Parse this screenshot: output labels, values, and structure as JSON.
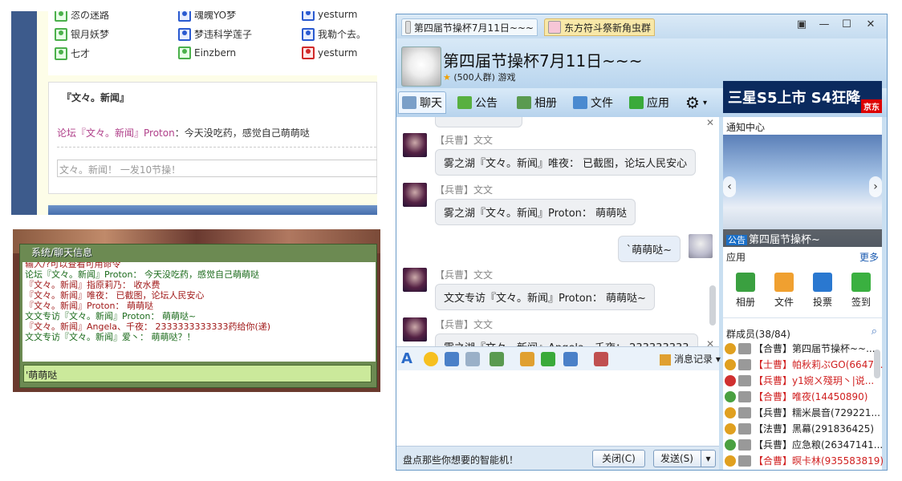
{
  "forum": {
    "users": [
      {
        "name": "恣の迷路",
        "color": "green"
      },
      {
        "name": "魂魄YO梦",
        "color": "blue"
      },
      {
        "name": "yesturm",
        "color": "blue"
      },
      {
        "name": "银月妖梦",
        "color": "green"
      },
      {
        "name": "梦违科学莲子",
        "color": "blue"
      },
      {
        "name": "我勒个去。",
        "color": "blue"
      },
      {
        "name": "七才",
        "color": "green"
      },
      {
        "name": "Einzbern",
        "color": "green"
      },
      {
        "name": "yesturm",
        "color": "red"
      }
    ],
    "card_title": "『文々。新闻』",
    "post_author": "论坛『文々。新闻』Proton",
    "post_text": "：今天没吃药，感觉自己萌萌哒",
    "input_value": "文々。新闻！ 一发10节操！"
  },
  "game": {
    "title": "系统/聊天信息",
    "messages": [
      {
        "text": "输入/?可以查看可用命令",
        "color": "#a01818"
      },
      {
        "text": "论坛『文々。新闻』Proton： 今天没吃药，感觉自己萌萌哒",
        "color": "#1a6a1a"
      },
      {
        "text": "『文々。新闻』指原莉乃： 收水费",
        "color": "#a01818"
      },
      {
        "text": "『文々。新闻』唯夜： 已截图，论坛人民安心",
        "color": "#a01818"
      },
      {
        "text": "『文々。新闻』Proton： 萌萌哒",
        "color": "#a01818"
      },
      {
        "text": "文文专访『文々。新闻』Proton： 萌萌哒~",
        "color": "#1a6a1a"
      },
      {
        "text": "『文々。新闻』Angela、千夜： 2333333333333药给你(递)",
        "color": "#a01818"
      },
      {
        "text": "文文专访『文々。新闻』爱丶： 萌萌哒？！",
        "color": "#1a6a1a"
      }
    ],
    "input_value": "'萌萌哒"
  },
  "qq": {
    "tab1": "第四届节操杯7月11日~~~",
    "tab2": "东方符斗祭新角虫群",
    "group_name": "第四届节操杯7月11日~~~",
    "group_info": "(500人群) 游戏",
    "toolbar": {
      "chat": "聊天",
      "notice": "公告",
      "album": "相册",
      "files": "文件",
      "apps": "应用"
    },
    "ad_text": "三星S5上市 S4狂降",
    "ad_brand": "京东",
    "chat": [
      {
        "name": "【兵曹】文文",
        "text": "雾之湖『文々。新闻』唯夜： 已截图，论坛人民安心"
      },
      {
        "name": "【兵曹】文文",
        "text": "雾之湖『文々。新闻』Proton： 萌萌哒"
      },
      {
        "name": "",
        "text": "`萌萌哒~"
      },
      {
        "name": "【兵曹】文文",
        "text": "文文专访『文々。新闻』Proton： 萌萌哒~"
      },
      {
        "name": "【兵曹】文文",
        "text": "雾之湖『文々。新闻』Angela、千夜： 233333333"
      }
    ],
    "history_label": "消息记录",
    "bottom_ad": "盘点那些你想要的智能机！",
    "close_label": "关闭(C)",
    "send_label": "发送(S)",
    "notice_center": "通知中心",
    "notice_tag": "公告",
    "notice_caption": "第四届节操杯~",
    "apps_label": "应用",
    "more_label": "更多",
    "apps": [
      "相册",
      "文件",
      "投票",
      "签到"
    ],
    "members_label": "群成员(38/84)",
    "members": [
      {
        "text": "【合曹】第四届节操杯~~...",
        "color": "#222"
      },
      {
        "text": "【士曹】帕秋莉ぷGO(6647...",
        "color": "#d02020"
      },
      {
        "text": "【兵曹】y1婉ㄨ殘玥丶|说...",
        "color": "#d02020"
      },
      {
        "text": "【合曹】唯夜(14450890)",
        "color": "#d02020"
      },
      {
        "text": "【兵曹】糯米晨音(729221...",
        "color": "#222"
      },
      {
        "text": "【法曹】黑幕(291836425)",
        "color": "#222"
      },
      {
        "text": "【兵曹】应急粮(26347141...",
        "color": "#222"
      },
      {
        "text": "【合曹】暝卡林(935583819)",
        "color": "#d02020"
      }
    ]
  }
}
